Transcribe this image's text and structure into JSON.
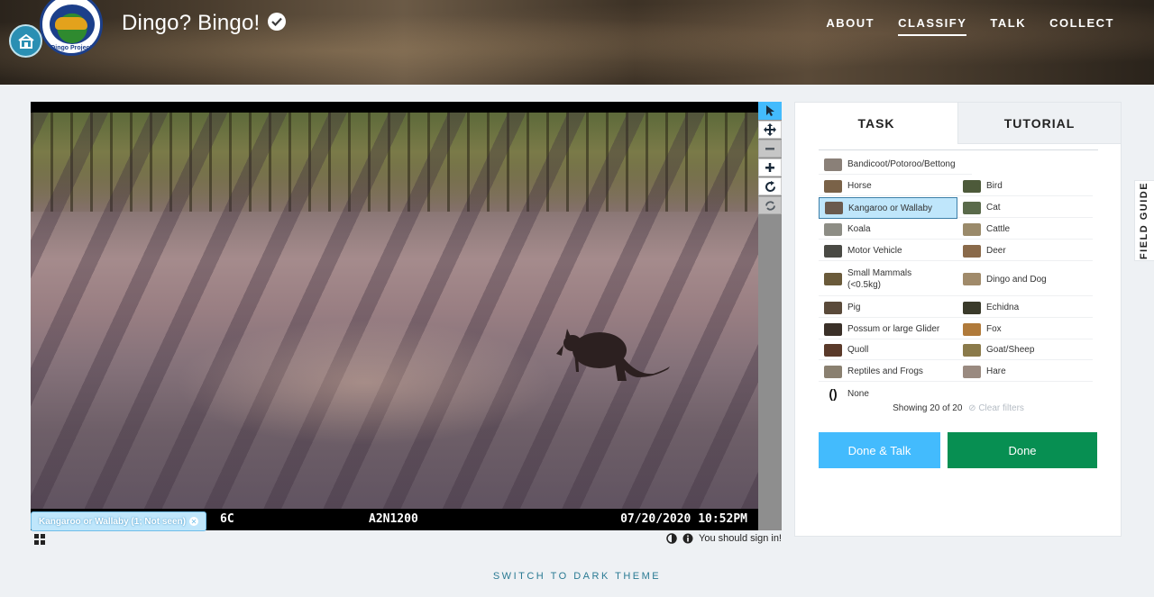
{
  "header": {
    "title": "Dingo? Bingo!",
    "logo_text": "Dingo Project",
    "nav": [
      {
        "label": "ABOUT",
        "active": false
      },
      {
        "label": "CLASSIFY",
        "active": true
      },
      {
        "label": "TALK",
        "active": false
      },
      {
        "label": "COLLECT",
        "active": false
      }
    ]
  },
  "viewer": {
    "temperature": "6C",
    "camera_id": "A2N1200",
    "timestamp": "07/20/2020  10:52PM",
    "mark_label": "Kangaroo or Wallaby (1; Not seen)",
    "signin_notice": "You should sign in!",
    "tools": [
      "pointer-icon",
      "pan-icon",
      "zoom-out-icon",
      "zoom-in-icon",
      "rotate-icon",
      "reset-icon"
    ]
  },
  "panel": {
    "tabs": [
      {
        "label": "TASK",
        "active": true
      },
      {
        "label": "TUTORIAL",
        "active": false
      }
    ],
    "choices": [
      {
        "label": "Bandicoot/Potoroo/Bettong",
        "color": "#8a8078"
      },
      {
        "label": "Horse",
        "color": "#7a6248"
      },
      {
        "label": "Bird",
        "color": "#4d5a3a"
      },
      {
        "label": "Kangaroo or Wallaby",
        "color": "#6a5a4e",
        "selected": true
      },
      {
        "label": "Cat",
        "color": "#5a6a4a"
      },
      {
        "label": "Koala",
        "color": "#8d8d85"
      },
      {
        "label": "Cattle",
        "color": "#9a8a6a"
      },
      {
        "label": "Motor Vehicle",
        "color": "#4a4a44"
      },
      {
        "label": "Deer",
        "color": "#8a6a4a"
      },
      {
        "label": "Small Mammals (<0.5kg)",
        "color": "#6a5a3a"
      },
      {
        "label": "Dingo and Dog",
        "color": "#a08a6a"
      },
      {
        "label": "Pig",
        "color": "#5a4a3a"
      },
      {
        "label": "Echidna",
        "color": "#3a3a2a"
      },
      {
        "label": "Possum or large Glider",
        "color": "#3a3028"
      },
      {
        "label": "Fox",
        "color": "#b07a3a"
      },
      {
        "label": "Quoll",
        "color": "#5a3a2a"
      },
      {
        "label": "Goat/Sheep",
        "color": "#8a7a4a"
      },
      {
        "label": "Reptiles and Frogs",
        "color": "#8a8070"
      },
      {
        "label": "Hare",
        "color": "#9a8a80"
      },
      {
        "label": "None",
        "icon": "empty-brackets-icon"
      }
    ],
    "showing": "Showing 20 of 20",
    "clear_filters": "Clear filters",
    "done_talk": "Done & Talk",
    "done": "Done"
  },
  "field_guide": "FIELD GUIDE",
  "theme_switch": "SWITCH TO DARK THEME",
  "colors": {
    "accent_blue": "#43bbfd",
    "done_green": "#078f52",
    "selected_bg": "#bfe6fb"
  }
}
